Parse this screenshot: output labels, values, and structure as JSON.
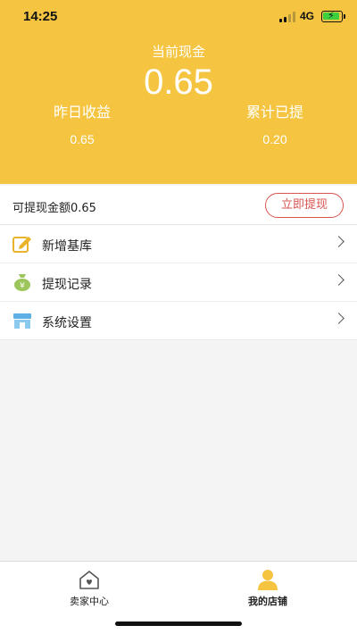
{
  "status_bar": {
    "time": "14:25",
    "network": "4G"
  },
  "header": {
    "cash_label": "当前现金",
    "cash_value": "0.65",
    "stats": [
      {
        "label": "昨日收益",
        "value": "0.65"
      },
      {
        "label": "累计已提",
        "value": "0.20"
      }
    ]
  },
  "withdraw": {
    "text": "可提现金额0.65",
    "button_label": "立即提现"
  },
  "menu": {
    "items": [
      {
        "label": "新增基库",
        "icon": "edit-icon"
      },
      {
        "label": "提现记录",
        "icon": "money-bag-icon"
      },
      {
        "label": "系统设置",
        "icon": "store-icon"
      }
    ]
  },
  "tabbar": {
    "tabs": [
      {
        "label": "卖家中心",
        "icon": "home-heart-icon",
        "active": false
      },
      {
        "label": "我的店铺",
        "icon": "user-icon",
        "active": true
      }
    ]
  },
  "colors": {
    "header_bg": "#f5c542",
    "accent_red": "#d9534f",
    "active_icon": "#f5c542"
  }
}
